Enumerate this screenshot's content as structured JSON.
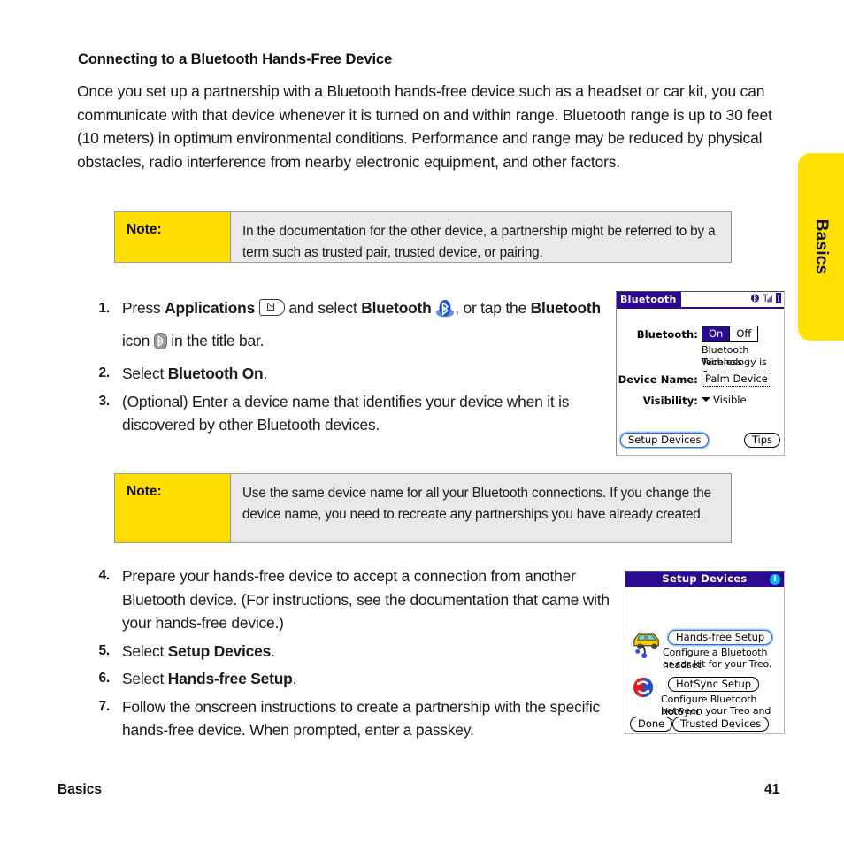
{
  "side_tab": {
    "label": "Basics",
    "color": "#FFE000"
  },
  "section": {
    "heading": "Connecting to a Bluetooth Hands-Free Device",
    "intro": "Once you set up a partnership with a Bluetooth hands-free device such as a headset or car kit, you can communicate with that device whenever it is turned on and within range. Bluetooth range is up to 30 feet (10 meters) in optimum environmental conditions. Performance and range may be reduced by physical obstacles, radio interference from nearby electronic equipment, and other factors."
  },
  "notes": [
    {
      "label": "Note:",
      "text": "In the documentation for the other device, a partnership might be referred to by a term such as trusted pair, trusted device, or pairing.",
      "label_bg": "#FFDD00",
      "body_bg": "#e9e9e9"
    },
    {
      "label": "Note:",
      "text": "Use the same device name for all your Bluetooth connections. If you change the device name, you need to recreate any partnerships you have already created.",
      "label_bg": "#FFDD00",
      "body_bg": "#e9e9e9"
    }
  ],
  "steps_group_a": [
    {
      "num": "1.",
      "parts": [
        {
          "t": "Press ",
          "b": false
        },
        {
          "t": "Applications",
          "b": true
        },
        {
          "t": " ",
          "b": false
        },
        {
          "icon": "applications-key-icon"
        },
        {
          "t": " and select ",
          "b": false
        },
        {
          "t": "Bluetooth",
          "b": true
        },
        {
          "t": " ",
          "b": false
        },
        {
          "icon": "bluetooth-app-icon"
        },
        {
          "t": ", or tap the ",
          "b": false
        },
        {
          "t": "Bluetooth",
          "b": true
        },
        {
          "t": " icon ",
          "b": false
        },
        {
          "icon": "bluetooth-titlebar-icon"
        },
        {
          "t": " in the title bar.",
          "b": false
        }
      ]
    },
    {
      "num": "2.",
      "parts": [
        {
          "t": "Select ",
          "b": false
        },
        {
          "t": "Bluetooth On",
          "b": true
        },
        {
          "t": ".",
          "b": false
        }
      ]
    },
    {
      "num": "3.",
      "parts": [
        {
          "t": "(Optional) Enter a device name that identifies your device when it is discovered by other Bluetooth devices.",
          "b": false
        }
      ]
    }
  ],
  "steps_group_b": [
    {
      "num": "4.",
      "parts": [
        {
          "t": "Prepare your hands-free device to accept a connection from another Bluetooth device. (For instructions, see the documentation that came with your hands-free device.)",
          "b": false
        }
      ]
    },
    {
      "num": "5.",
      "parts": [
        {
          "t": "Select ",
          "b": false
        },
        {
          "t": "Setup Devices",
          "b": true
        },
        {
          "t": ".",
          "b": false
        }
      ]
    },
    {
      "num": "6.",
      "parts": [
        {
          "t": "Select ",
          "b": false
        },
        {
          "t": "Hands-free Setup",
          "b": true
        },
        {
          "t": ".",
          "b": false
        }
      ]
    },
    {
      "num": "7.",
      "parts": [
        {
          "t": "Follow the onscreen instructions to create a partnership with the specific hands-free device. When prompted, enter a passkey.",
          "b": false
        }
      ]
    }
  ],
  "bluetooth_screen": {
    "title": "Bluetooth",
    "status_icons": [
      "bluetooth-icon",
      "signal-strength-icon",
      "battery-icon"
    ],
    "bluetooth_label": "Bluetooth:",
    "toggle_on": "On",
    "toggle_off": "Off",
    "toggle_selected": "On",
    "status_line1": "Bluetooth Wireless",
    "status_line2": "Technology is On",
    "device_name_label": "Device Name:",
    "device_name_value": "Palm Device",
    "visibility_label": "Visibility:",
    "visibility_value": "Visible",
    "setup_devices_button": "Setup Devices",
    "tips_button": "Tips",
    "accent": "#2b0a8f"
  },
  "setup_devices_screen": {
    "title": "Setup Devices",
    "info_icon": "i",
    "handsfree_button": "Hands-free Setup",
    "handsfree_desc_line1": "Configure a Bluetooth headset",
    "handsfree_desc_line2": "or car kit for your Treo.",
    "hotsync_button": "HotSync Setup",
    "hotsync_desc_line1": "Configure Bluetooth HotSync",
    "hotsync_desc_line2": "between your Treo and PC.",
    "done_button": "Done",
    "trusted_devices_button": "Trusted Devices",
    "accent": "#2b0a8f"
  },
  "footer": {
    "left": "Basics",
    "right": "41"
  }
}
